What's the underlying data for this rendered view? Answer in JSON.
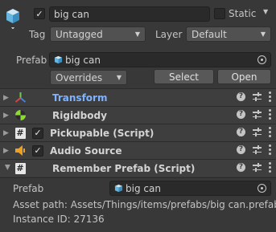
{
  "header": {
    "active": true,
    "name": "big can",
    "static_label": "Static",
    "static_checked": false,
    "tag_label": "Tag",
    "tag_value": "Untagged",
    "layer_label": "Layer",
    "layer_value": "Default"
  },
  "prefab": {
    "label": "Prefab",
    "asset": "big can",
    "overrides": "Overrides",
    "select": "Select",
    "open": "Open"
  },
  "components": [
    {
      "name": "Transform",
      "icon": "transform-axes-icon",
      "has_checkbox": false,
      "expanded": false,
      "color": "#7fb2ff"
    },
    {
      "name": "Rigidbody",
      "icon": "rigidbody-ball-icon",
      "has_checkbox": false,
      "expanded": false
    },
    {
      "name": "Pickupable (Script)",
      "icon": "script-hash-icon",
      "has_checkbox": true,
      "checked": true,
      "expanded": false
    },
    {
      "name": "Audio Source",
      "icon": "speaker-icon",
      "has_checkbox": true,
      "checked": true,
      "expanded": false
    },
    {
      "name": "Remember Prefab (Script)",
      "icon": "script-hash-icon",
      "has_checkbox": false,
      "expanded": true
    }
  ],
  "remember_prefab": {
    "prefab_label": "Prefab",
    "prefab_value": "big can",
    "asset_path": "Asset path: Assets/Things/items/prefabs/big can.prefab",
    "instance_id": "Instance ID: 27136"
  },
  "colors": {
    "background": "#383838",
    "field": "#2a2a2a",
    "transform_label": "#7fb2ff",
    "rigidbody_icon": "#8ed838",
    "audio_icon": "#f0a020"
  }
}
